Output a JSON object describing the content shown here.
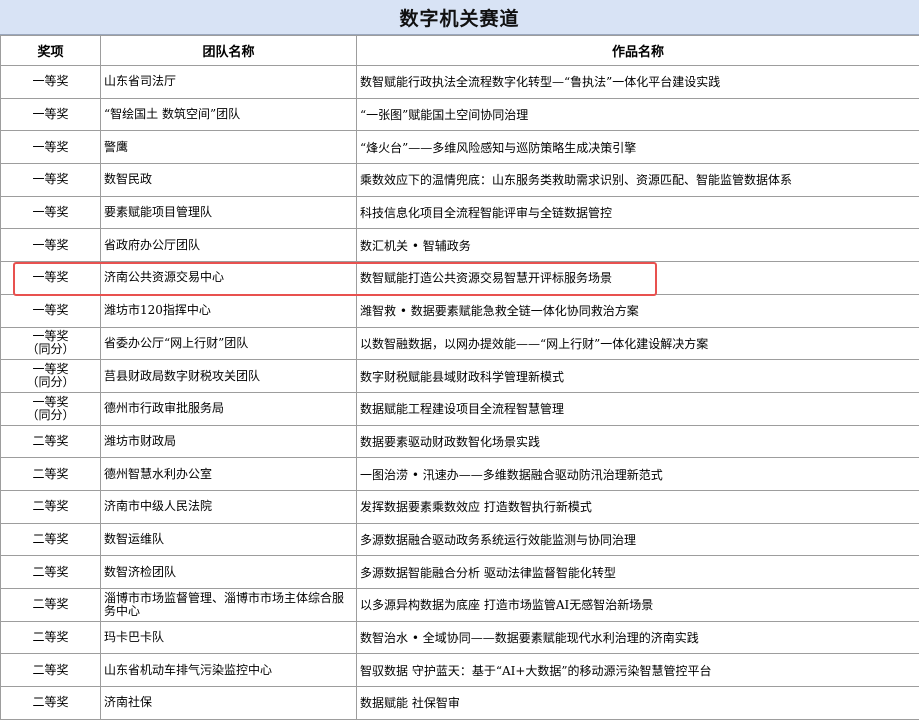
{
  "title": "数字机关赛道",
  "headers": {
    "award": "奖项",
    "team": "团队名称",
    "work": "作品名称"
  },
  "highlight_color": "#e8514f",
  "rows": [
    {
      "award": "一等奖",
      "team": "山东省司法厅",
      "work": "数智赋能行政执法全流程数字化转型—“鲁执法”一体化平台建设实践"
    },
    {
      "award": "一等奖",
      "team": "“智绘国土 数筑空间”团队",
      "work": "“一张图”赋能国土空间协同治理"
    },
    {
      "award": "一等奖",
      "team": "警鹰",
      "work": "“烽火台”——多维风险感知与巡防策略生成决策引擎"
    },
    {
      "award": "一等奖",
      "team": "数智民政",
      "work": "乘数效应下的温情兜底：山东服务类救助需求识别、资源匹配、智能监管数据体系"
    },
    {
      "award": "一等奖",
      "team": "要素赋能项目管理队",
      "work": "科技信息化项目全流程智能评审与全链数据管控"
    },
    {
      "award": "一等奖",
      "team": "省政府办公厅团队",
      "work": "数汇机关 • 智辅政务"
    },
    {
      "award": "一等奖",
      "team": "济南公共资源交易中心",
      "work": "数智赋能打造公共资源交易智慧开评标服务场景"
    },
    {
      "award": "一等奖",
      "team": "潍坊市120指挥中心",
      "work": "潍智救 • 数据要素赋能急救全链一体化协同救治方案"
    },
    {
      "award": "一等奖\n（同分）",
      "team": "省委办公厅“网上行财”团队",
      "work": "以数智融数据，以网办提效能——“网上行财”一体化建设解决方案"
    },
    {
      "award": "一等奖\n（同分）",
      "team": "莒县财政局数字财税攻关团队",
      "work": "数字财税赋能县域财政科学管理新模式"
    },
    {
      "award": "一等奖\n（同分）",
      "team": "德州市行政审批服务局",
      "work": "数据赋能工程建设项目全流程智慧管理"
    },
    {
      "award": "二等奖",
      "team": "潍坊市财政局",
      "work": "数据要素驱动财政数智化场景实践"
    },
    {
      "award": "二等奖",
      "team": "德州智慧水利办公室",
      "work": "一图治涝 • 汛速办——多维数据融合驱动防汛治理新范式"
    },
    {
      "award": "二等奖",
      "team": "济南市中级人民法院",
      "work": "发挥数据要素乘数效应 打造数智执行新模式"
    },
    {
      "award": "二等奖",
      "team": "数智运维队",
      "work": "多源数据融合驱动政务系统运行效能监测与协同治理"
    },
    {
      "award": "二等奖",
      "team": "数智济检团队",
      "work": "多源数据智能融合分析 驱动法律监督智能化转型"
    },
    {
      "award": "二等奖",
      "team": "淄博市市场监督管理、淄博市市场主体综合服务中心",
      "work": "以多源异构数据为底座 打造市场监管AI无感智治新场景"
    },
    {
      "award": "二等奖",
      "team": "玛卡巴卡队",
      "work": "数智治水 • 全域协同——数据要素赋能现代水利治理的济南实践"
    },
    {
      "award": "二等奖",
      "team": "山东省机动车排气污染监控中心",
      "work": "智驭数据 守护蓝天：基于“AI+大数据”的移动源污染智慧管控平台"
    },
    {
      "award": "二等奖",
      "team": "济南社保",
      "work": "数据赋能 社保智审"
    }
  ]
}
